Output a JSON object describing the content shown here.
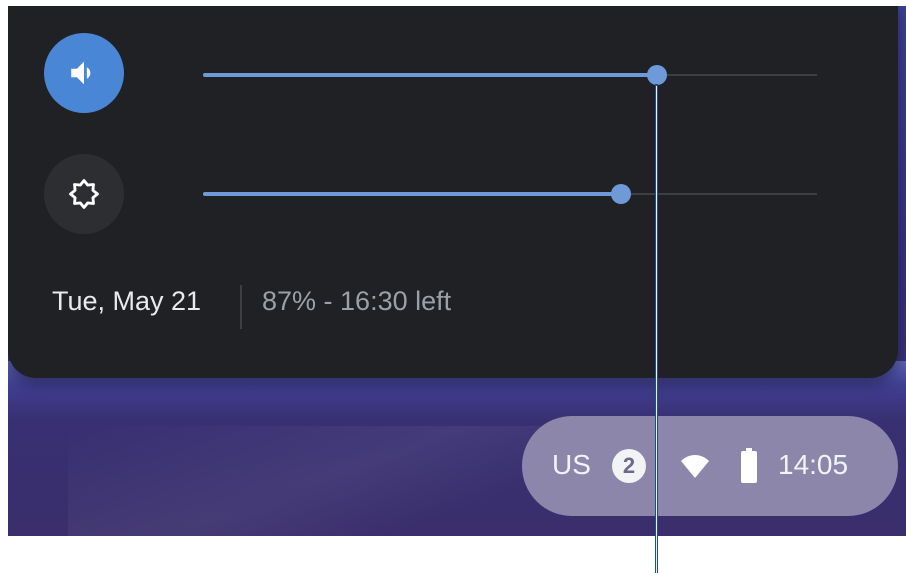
{
  "quick_settings": {
    "volume": {
      "icon": "speaker-icon",
      "level_fraction": 0.74
    },
    "brightness": {
      "icon": "brightness-icon",
      "level_fraction": 0.68
    },
    "date_label": "Tue, May 21",
    "battery_label": "87% - 16:30 left"
  },
  "shelf": {
    "ime_label": "US",
    "notification_count": "2",
    "wifi_icon": "wifi-icon",
    "battery_icon": "battery-icon",
    "time_label": "14:05"
  },
  "colors": {
    "accent": "#4a86d6",
    "panel_background": "#202124",
    "slider_fill": "#6f9ad8",
    "callout_line": "#1f4f7a"
  }
}
